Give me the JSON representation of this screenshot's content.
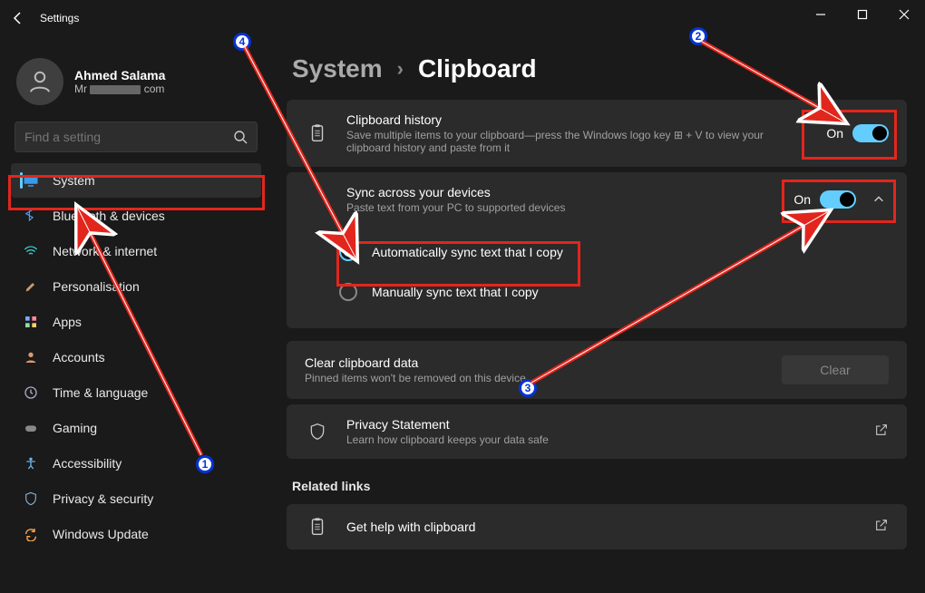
{
  "window": {
    "title": "Settings"
  },
  "user": {
    "name": "Ahmed Salama",
    "email_prefix": "Mr",
    "email_suffix": "com"
  },
  "search": {
    "placeholder": "Find a setting"
  },
  "nav": [
    {
      "label": "System",
      "icon": "monitor",
      "active": true
    },
    {
      "label": "Bluetooth & devices",
      "icon": "bluetooth"
    },
    {
      "label": "Network & internet",
      "icon": "wifi"
    },
    {
      "label": "Personalisation",
      "icon": "brush"
    },
    {
      "label": "Apps",
      "icon": "apps"
    },
    {
      "label": "Accounts",
      "icon": "person"
    },
    {
      "label": "Time & language",
      "icon": "clock"
    },
    {
      "label": "Gaming",
      "icon": "game"
    },
    {
      "label": "Accessibility",
      "icon": "access"
    },
    {
      "label": "Privacy & security",
      "icon": "shield"
    },
    {
      "label": "Windows Update",
      "icon": "update"
    }
  ],
  "breadcrumb": {
    "parent": "System",
    "current": "Clipboard"
  },
  "cards": {
    "history": {
      "title": "Clipboard history",
      "desc": "Save multiple items to your clipboard—press the Windows logo key ⊞ + V to view your clipboard history and paste from it",
      "toggle_label": "On"
    },
    "sync": {
      "title": "Sync across your devices",
      "desc": "Paste text from your PC to supported devices",
      "toggle_label": "On",
      "opt_auto": "Automatically sync text that I copy",
      "opt_manual": "Manually sync text that I copy"
    },
    "clear": {
      "title": "Clear clipboard data",
      "desc": "Pinned items won't be removed on this device",
      "btn": "Clear"
    },
    "privacy": {
      "title": "Privacy Statement",
      "desc": "Learn how clipboard keeps your data safe"
    },
    "related_title": "Related links",
    "help": {
      "title": "Get help with clipboard"
    }
  },
  "markers": {
    "m1": "1",
    "m2": "2",
    "m3": "3",
    "m4": "4"
  }
}
